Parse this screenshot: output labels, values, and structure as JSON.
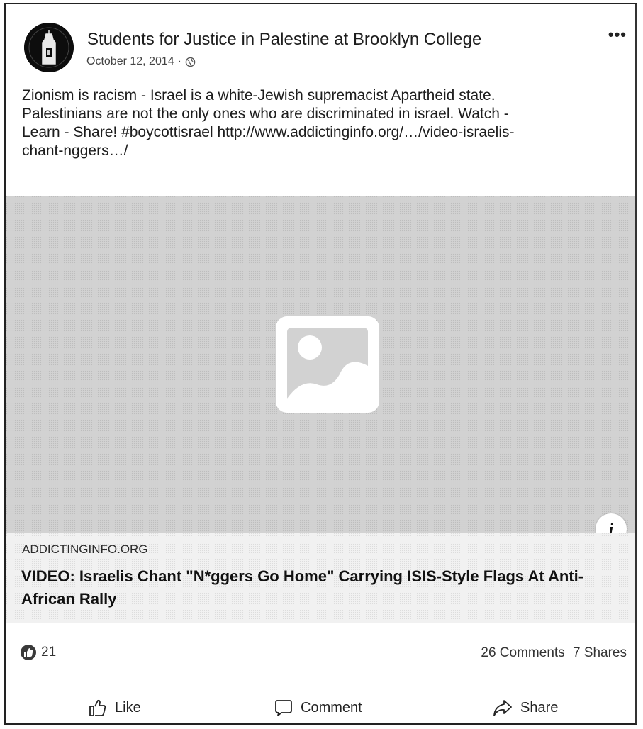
{
  "post": {
    "page_name": "Students for Justice in Palestine at Brooklyn College",
    "date": "October 12, 2014",
    "date_separator": "·",
    "more_label": "•••",
    "text_lines": [
      "Zionism is racism - Israel is a white-Jewish supremacist Apartheid state.",
      "Palestinians are not the only ones who are discriminated in israel. Watch -",
      "Learn - Share! #boycottisrael http://www.addictinginfo.org/…/video-israelis-",
      "chant-nggers…/"
    ]
  },
  "link_preview": {
    "info_label": "i",
    "domain": "ADDICTINGINFO.ORG",
    "title": "VIDEO: Israelis Chant \"N*ggers Go Home\" Carrying ISIS-Style Flags At Anti-African Rally"
  },
  "stats": {
    "reaction_count": "21",
    "comments": "26 Comments",
    "shares": "7 Shares"
  },
  "actions": {
    "like": "Like",
    "comment": "Comment",
    "share": "Share"
  },
  "icons": {
    "avatar": "avatar-logo-icon",
    "globe": "globe-icon",
    "placeholder": "image-placeholder-icon",
    "reaction": "like-reaction-icon",
    "like": "thumbs-up-icon",
    "comment": "comment-bubble-icon",
    "share": "share-arrow-icon"
  }
}
